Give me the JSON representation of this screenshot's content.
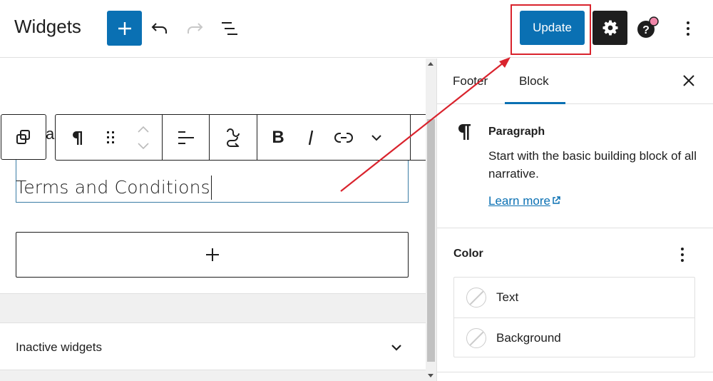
{
  "header": {
    "title": "Widgets",
    "add_block_label": "Add block",
    "undo_label": "Undo",
    "redo_label": "Redo",
    "list_view_label": "List view",
    "update_label": "Update",
    "settings_label": "Settings",
    "help_label": "Help",
    "options_label": "Options",
    "brand_color": "#0a70b3",
    "help_badge_color": "#f086a9"
  },
  "editor": {
    "partial_text": "a",
    "paragraph_text": "Terms and Conditions",
    "appender_label": "+",
    "toolbar": {
      "buttons": [
        "Select parent block",
        "Paragraph",
        "Drag",
        "Move up/down",
        "Align text",
        "Transform",
        "Bold",
        "Italic",
        "Link",
        "More"
      ]
    },
    "inactive_widgets_label": "Inactive widgets"
  },
  "sidebar": {
    "tabs": [
      {
        "label": "Footer",
        "active": false
      },
      {
        "label": "Block",
        "active": true
      }
    ],
    "block_card": {
      "icon": "¶",
      "title": "Paragraph",
      "description": "Start with the basic building block of all narrative.",
      "learn_more": "Learn more"
    },
    "color": {
      "title": "Color",
      "items": [
        {
          "label": "Text"
        },
        {
          "label": "Background"
        }
      ]
    }
  },
  "annotation": {
    "highlight_color": "#d9232d"
  }
}
